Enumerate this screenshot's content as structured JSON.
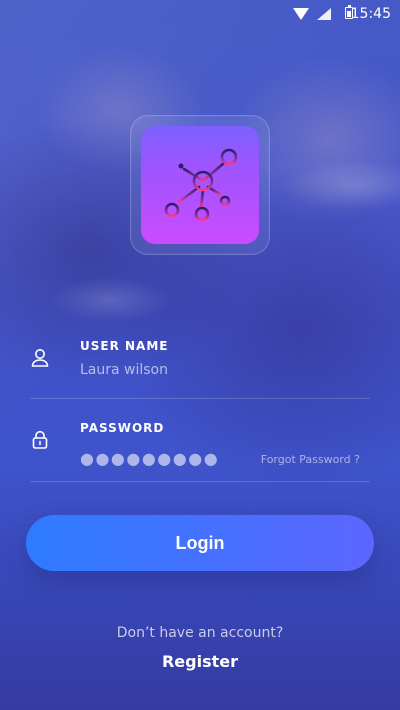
{
  "status_bar": {
    "time": "15:45",
    "wifi_icon": "wifi-icon",
    "signal_icon": "signal-icon",
    "battery_icon": "battery-icon"
  },
  "logo": {
    "icon": "network-icon",
    "colors": {
      "top": "#7d60ff",
      "middle": "#9e54ff",
      "bottom": "#ca4cff",
      "stroke_top": "#2b1f64",
      "stroke_bottom": "#ff3b88"
    }
  },
  "fields": {
    "username": {
      "label": "USER NAME",
      "value": "Laura wilson",
      "icon": "user-icon"
    },
    "password": {
      "label": "PASSWORD",
      "value": "●●●●●●●●●",
      "icon": "lock-icon",
      "forgot_label": "Forgot Password ?"
    }
  },
  "actions": {
    "login_label": "Login",
    "signup_prompt": "Don’t have an account?",
    "register_label": "Register"
  },
  "colors": {
    "background_primary": "#4459c7",
    "background_secondary": "#3d4fc4",
    "button_start": "#2e7bff",
    "button_end": "#5d66ff"
  }
}
